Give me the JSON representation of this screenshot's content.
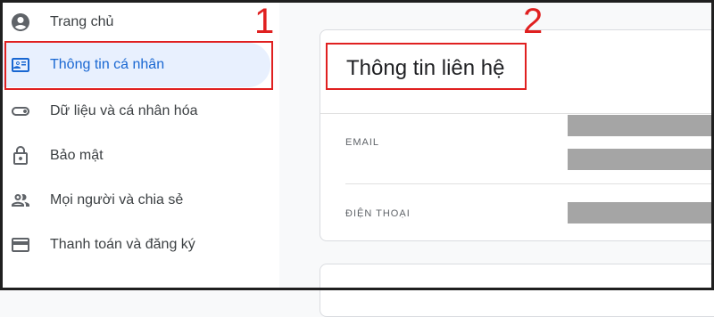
{
  "sidebar": {
    "items": [
      {
        "label": "Trang chủ",
        "icon": "account-circle-icon"
      },
      {
        "label": "Thông tin cá nhân",
        "icon": "id-card-icon",
        "active": true
      },
      {
        "label": "Dữ liệu và cá nhân hóa",
        "icon": "toggle-icon"
      },
      {
        "label": "Bảo mật",
        "icon": "lock-icon"
      },
      {
        "label": "Mọi người và chia sẻ",
        "icon": "people-icon"
      },
      {
        "label": "Thanh toán và đăng ký",
        "icon": "credit-card-icon"
      }
    ]
  },
  "contact_card": {
    "title": "Thông tin liên hệ",
    "email_label": "EMAIL",
    "phone_label": "ĐIỆN THOẠI"
  },
  "annotations": {
    "marker_1": "1",
    "marker_2": "2"
  },
  "colors": {
    "accent": "#1967d2",
    "active_bg": "#e8f0fe",
    "annotation_red": "#e02020",
    "redaction_gray": "#a5a5a5"
  }
}
